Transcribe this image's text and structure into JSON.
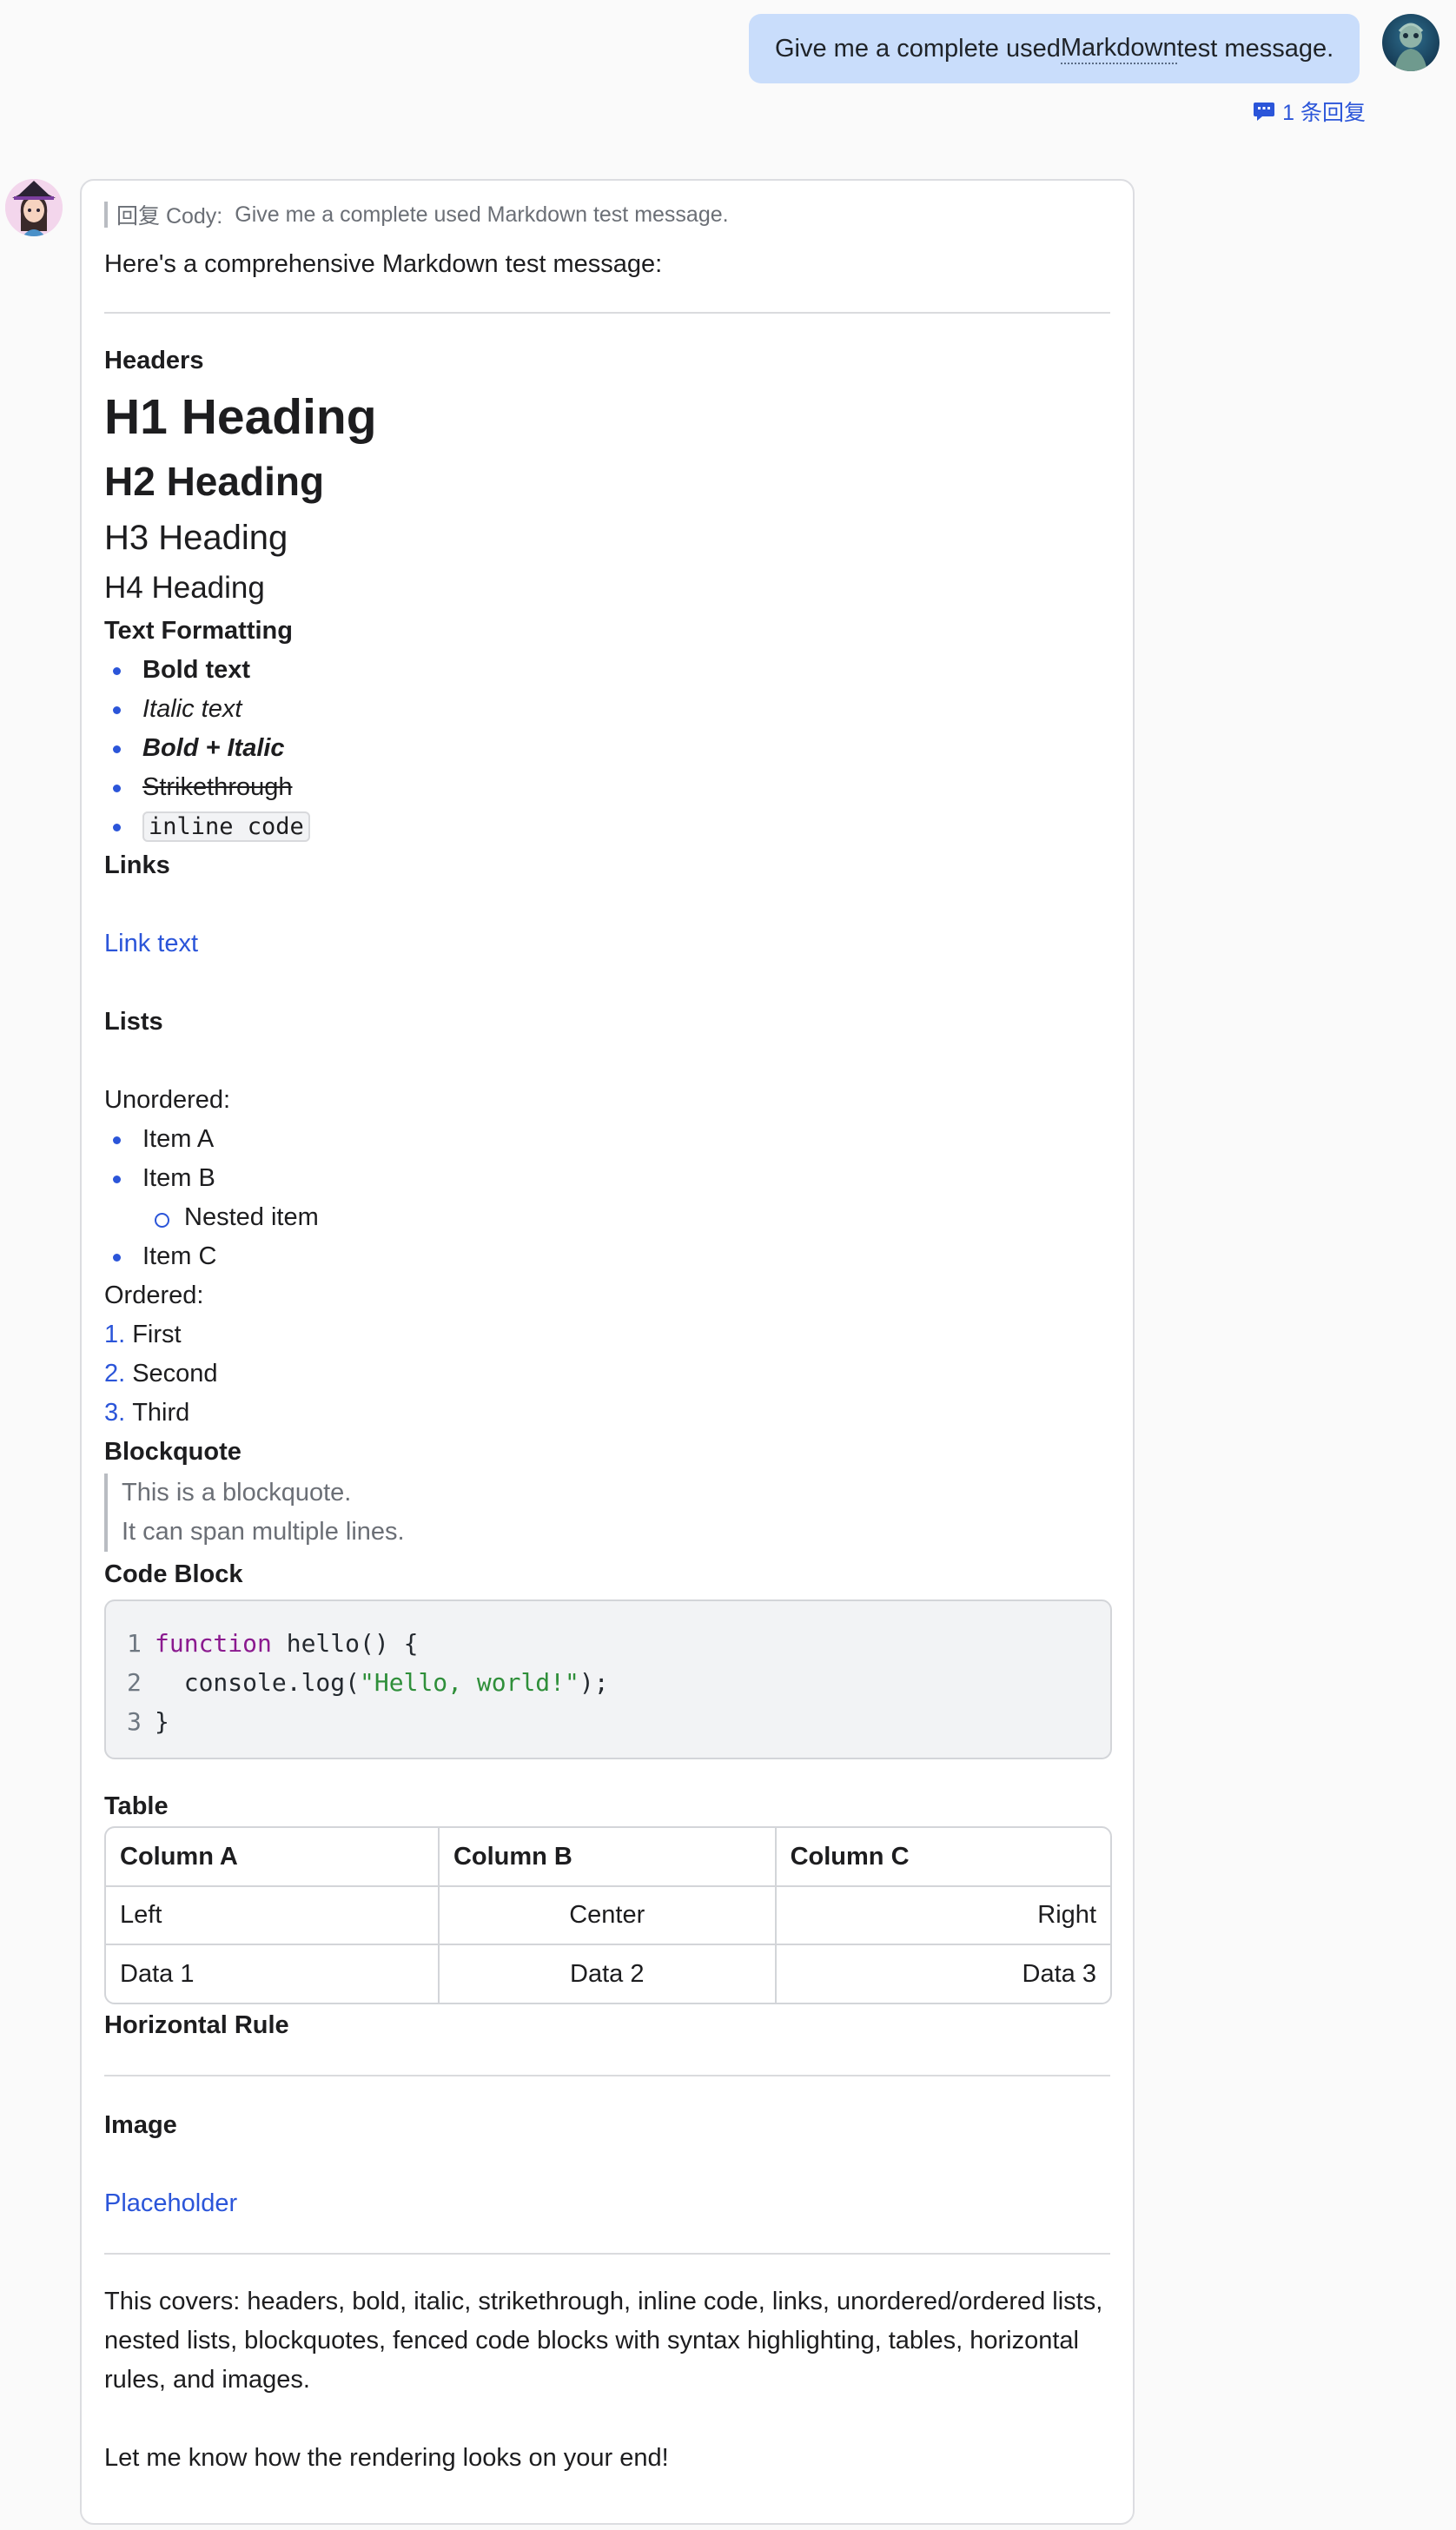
{
  "user_message": {
    "text_before": "Give me a complete used ",
    "abbr": "Markdown",
    "text_after": " test message.",
    "replies_label": "1 条回复"
  },
  "bot_message": {
    "reply_quote": {
      "prefix": "回复 Cody:",
      "text": "Give me a complete used Markdown test message."
    },
    "intro": "Here's a comprehensive Markdown test message:",
    "headers_section": "Headers",
    "h1": "H1 Heading",
    "h2": "H2 Heading",
    "h3": "H3 Heading",
    "h4": "H4 Heading",
    "formatting_section": "Text Formatting",
    "formatting": {
      "bold": "Bold text",
      "italic": "Italic text",
      "bold_italic": "Bold + Italic",
      "strike": "Strikethrough",
      "inline_code": "inline code"
    },
    "links_section": "Links",
    "link_text": "Link text",
    "lists_section": "Lists",
    "unordered_label": "Unordered:",
    "unordered": [
      "Item A",
      "Item B",
      "Nested item",
      "Item C"
    ],
    "ordered_label": "Ordered:",
    "ordered": [
      {
        "num": "1.",
        "text": "First"
      },
      {
        "num": "2.",
        "text": "Second"
      },
      {
        "num": "3.",
        "text": "Third"
      }
    ],
    "blockquote_section": "Blockquote",
    "blockquote": [
      "This is a blockquote.",
      "It can span multiple lines."
    ],
    "code_section": "Code Block",
    "code": {
      "line_numbers": [
        "1",
        "2",
        "3"
      ],
      "l1_kw": "function",
      "l1_rest": " hello() {",
      "l2_pre": "  console.log(",
      "l2_str": "\"Hello, world!\"",
      "l2_post": ");",
      "l3": "}"
    },
    "table_section": "Table",
    "table": {
      "headers": [
        "Column A",
        "Column B",
        "Column C"
      ],
      "rows": [
        [
          "Left",
          "Center",
          "Right"
        ],
        [
          "Data 1",
          "Data 2",
          "Data 3"
        ]
      ]
    },
    "hr_section": "Horizontal Rule",
    "image_section": "Image",
    "image_link": "Placeholder",
    "outro": "This covers: headers, bold, italic, strikethrough, inline code, links, unordered/ordered lists, nested lists, blockquotes, fenced code blocks with syntax highlighting, tables, horizontal rules, and images.",
    "closing": "Let me know how the rendering looks on your end!"
  },
  "colors": {
    "accent": "#2b55d9",
    "user_bubble": "#c9ddfb",
    "keyword": "#8b1a8f",
    "string": "#2f8f3a"
  }
}
